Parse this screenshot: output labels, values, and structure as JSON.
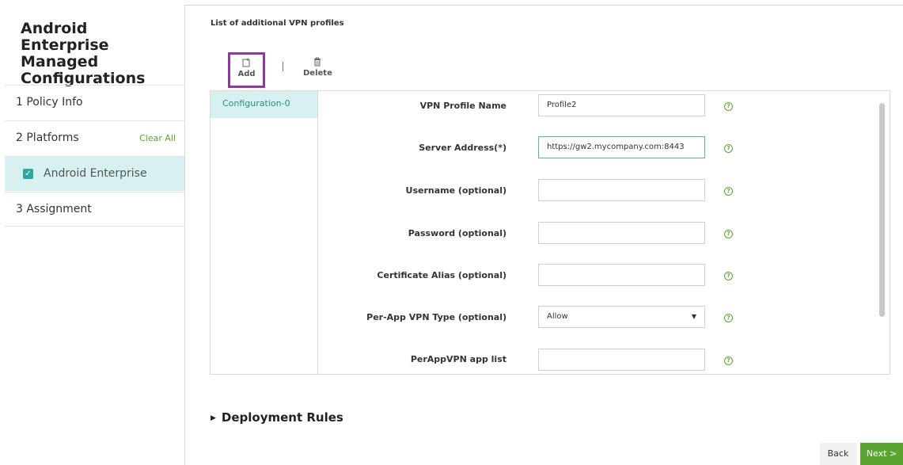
{
  "sidebar": {
    "title_lines": [
      "Android Enterprise",
      "Managed",
      "Configurations"
    ],
    "steps": [
      {
        "label": "1 Policy Info"
      },
      {
        "label": "2 Platforms",
        "action": "Clear All"
      },
      {
        "label": "Android Enterprise",
        "checked": true
      },
      {
        "label": "3 Assignment"
      }
    ]
  },
  "main": {
    "list_title": "List of additional VPN profiles",
    "toolbar": {
      "add_label": "Add",
      "delete_label": "Delete"
    },
    "configurations": [
      {
        "label": "Configuration-0"
      }
    ],
    "fields": [
      {
        "label": "VPN Profile Name",
        "value": "Profile2"
      },
      {
        "label": "Server Address(*)",
        "value": "https://gw2.mycompany.com:8443"
      },
      {
        "label": "Username (optional)",
        "value": ""
      },
      {
        "label": "Password (optional)",
        "value": ""
      },
      {
        "label": "Certificate Alias (optional)",
        "value": ""
      },
      {
        "label": "Per-App VPN Type (optional)",
        "value": "Allow"
      },
      {
        "label": "PerAppVPN app list",
        "value": ""
      }
    ],
    "help_glyph": "?",
    "deployment_rules_label": "Deployment Rules"
  },
  "footer": {
    "back_label": "Back",
    "next_label": "Next >"
  },
  "colors": {
    "accent_green": "#5aa531",
    "selected_bg": "#d6f1f0",
    "teal": "#2da6a0",
    "highlight_box": "#8a3d96"
  }
}
